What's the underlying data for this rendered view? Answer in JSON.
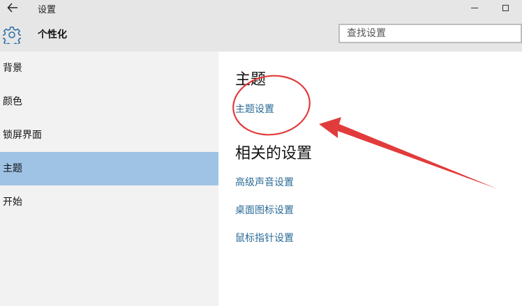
{
  "window": {
    "title": "设置"
  },
  "header": {
    "title": "个性化",
    "search_placeholder": "查找设置"
  },
  "sidebar": {
    "items": [
      {
        "label": "背景",
        "selected": false
      },
      {
        "label": "颜色",
        "selected": false
      },
      {
        "label": "锁屏界面",
        "selected": false
      },
      {
        "label": "主题",
        "selected": true
      },
      {
        "label": "开始",
        "selected": false
      }
    ]
  },
  "main": {
    "theme_heading": "主题",
    "theme_settings_link": "主题设置",
    "related_heading": "相关的设置",
    "related_links": [
      "高级声音设置",
      "桌面图标设置",
      "鼠标指针设置"
    ]
  },
  "colors": {
    "chrome": "#e6e6e6",
    "sidebar_bg": "#f2f2f2",
    "selected_bg": "#9ec3e4",
    "link": "#2b6c97",
    "annotation_red": "#e23b3b"
  },
  "icons": {
    "back": "back-arrow-icon",
    "settings": "gear-icon",
    "minimize": "minimize-icon",
    "maximize": "maximize-icon"
  }
}
